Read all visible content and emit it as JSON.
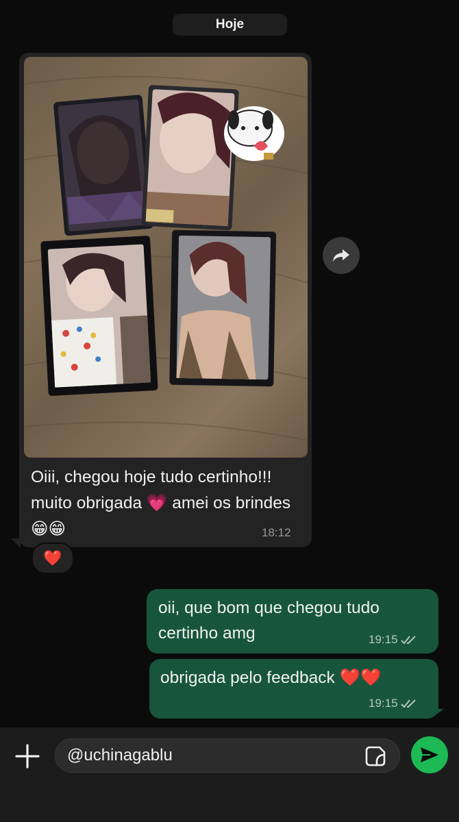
{
  "date_separator": "Hoje",
  "incoming": {
    "text": "Oiii, chegou hoje tudo certinho!!! muito obrigada 💗 amei os brindes 😁😁",
    "time": "18:12",
    "reaction": "❤️",
    "attachment_icon": "photo"
  },
  "outgoing": [
    {
      "text": "oii, que bom que chegou tudo certinho amg",
      "time": "19:15",
      "status_icon": "double-check-icon"
    },
    {
      "text": "obrigada pelo feedback ❤️❤️",
      "time": "19:15",
      "status_icon": "double-check-icon"
    }
  ],
  "composer": {
    "value": "@uchinagablu",
    "plus_icon": "plus-icon",
    "sticker_icon": "sticker-icon",
    "send_icon": "send-icon"
  },
  "colors": {
    "background": "#0b0b0b",
    "incoming_bubble": "#232323",
    "outgoing_bubble": "#17563c",
    "send_button": "#1db954"
  }
}
